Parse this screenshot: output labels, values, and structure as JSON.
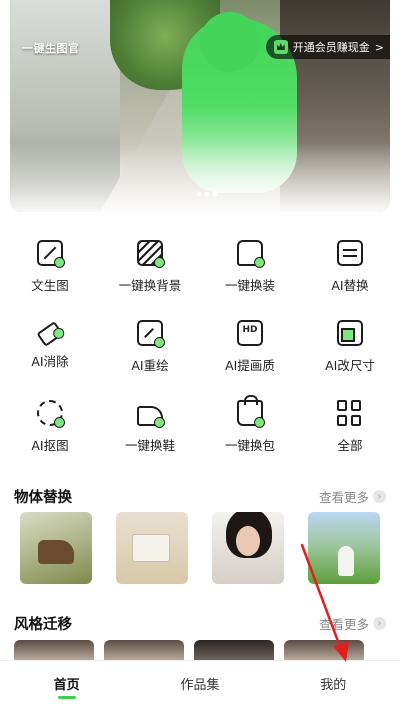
{
  "hero": {
    "logo_text": "一键生图官",
    "vip_label": "开通会员赚现金",
    "vip_chevron": ">"
  },
  "tools": [
    {
      "label": "文生图",
      "icon": "text-to-image-icon"
    },
    {
      "label": "一键换背景",
      "icon": "change-background-icon"
    },
    {
      "label": "一键换装",
      "icon": "change-outfit-icon"
    },
    {
      "label": "AI替换",
      "icon": "ai-replace-icon"
    },
    {
      "label": "AI消除",
      "icon": "ai-erase-icon"
    },
    {
      "label": "AI重绘",
      "icon": "ai-redraw-icon"
    },
    {
      "label": "AI提画质",
      "icon": "hd-icon"
    },
    {
      "label": "AI改尺寸",
      "icon": "resize-icon"
    },
    {
      "label": "AI抠图",
      "icon": "cutout-icon"
    },
    {
      "label": "一键换鞋",
      "icon": "shoe-icon"
    },
    {
      "label": "一键换包",
      "icon": "bag-icon"
    },
    {
      "label": "全部",
      "icon": "grid-icon"
    }
  ],
  "sections": {
    "object_replace": {
      "title": "物体替换",
      "more": "查看更多"
    },
    "style_transfer": {
      "title": "风格迁移",
      "more": "查看更多"
    }
  },
  "tabbar": {
    "home": "首页",
    "works": "作品集",
    "mine": "我的"
  },
  "colors": {
    "accent": "#3ecf4e",
    "annotation_arrow": "#e02020"
  }
}
